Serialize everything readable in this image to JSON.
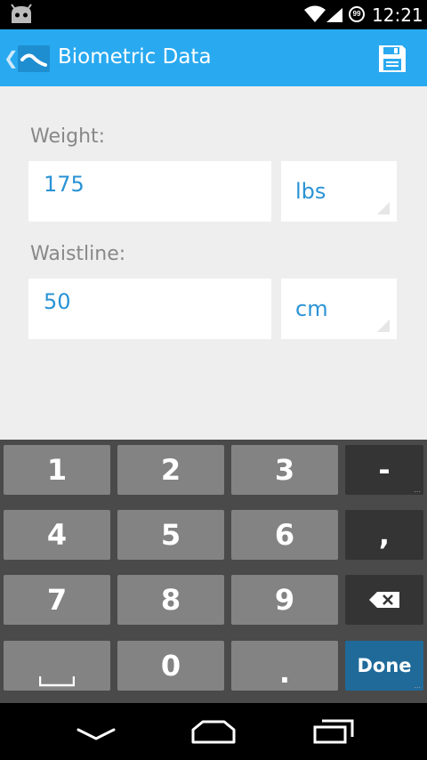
{
  "status_bar": {
    "time": "12:21",
    "battery": "99",
    "icons": [
      "android-icon",
      "wifi-icon",
      "signal-icon",
      "battery-icon"
    ]
  },
  "action_bar": {
    "title": "Biometric Data",
    "back_icon": "chevron-left-icon",
    "app_icon": "app-logo-icon",
    "save_icon": "save-icon",
    "background": "#29a9f0"
  },
  "form": {
    "weight_label": "Weight:",
    "weight_value": "175",
    "weight_unit": "lbs",
    "waist_label": "Waistline:",
    "waist_value": "50",
    "waist_unit": "cm",
    "value_color": "#2a93d5"
  },
  "keyboard": {
    "keys": [
      "1",
      "2",
      "3",
      "-",
      "4",
      "5",
      "6",
      ",",
      "7",
      "8",
      "9",
      "backspace",
      "space",
      "0",
      ".",
      "Done"
    ],
    "done_label": "Done",
    "done_color": "#1f6a99"
  },
  "nav_bar": {
    "icons": [
      "back-icon",
      "home-icon",
      "recents-icon"
    ]
  }
}
